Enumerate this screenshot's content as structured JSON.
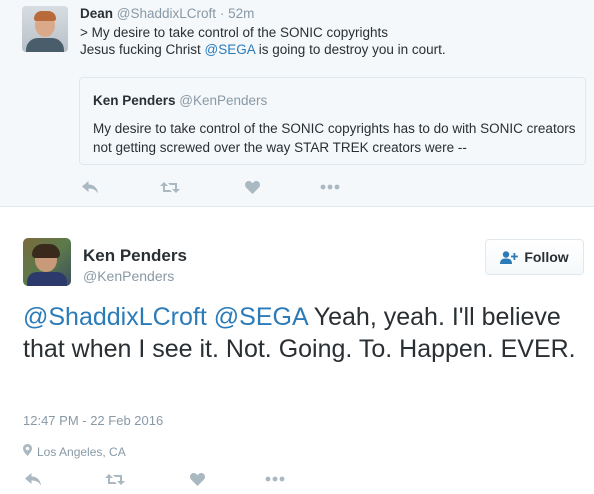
{
  "parent_tweet": {
    "name": "Dean",
    "handle": "@ShaddixLCroft",
    "separator": "·",
    "time": "52m",
    "line1": "> My desire to take control of the SONIC copyrights",
    "line2_pre": "Jesus fucking Christ ",
    "line2_mention": "@SEGA",
    "line2_post": " is going to destroy you in court.",
    "quote": {
      "name": "Ken Penders",
      "handle": "@KenPenders",
      "text": "My desire to take control of the SONIC copyrights has to do with SONIC creators not getting screwed over the way STAR TREK creators were --"
    }
  },
  "main_tweet": {
    "name": "Ken Penders",
    "handle": "@KenPenders",
    "follow_label": "Follow",
    "mention1": "@ShaddixLCroft",
    "mention2": "@SEGA",
    "text": " Yeah, yeah. I'll believe that when I see it. Not. Going. To. Happen. EVER.",
    "timestamp": "12:47 PM - 22 Feb 2016",
    "location": "Los Angeles, CA"
  },
  "colors": {
    "link": "#2b7bb9",
    "muted": "#8899a6",
    "icon": "#aab8c2",
    "text": "#292f33"
  },
  "icons": [
    "reply-icon",
    "retweet-icon",
    "like-icon",
    "more-icon",
    "add-user-icon",
    "location-pin-icon"
  ]
}
